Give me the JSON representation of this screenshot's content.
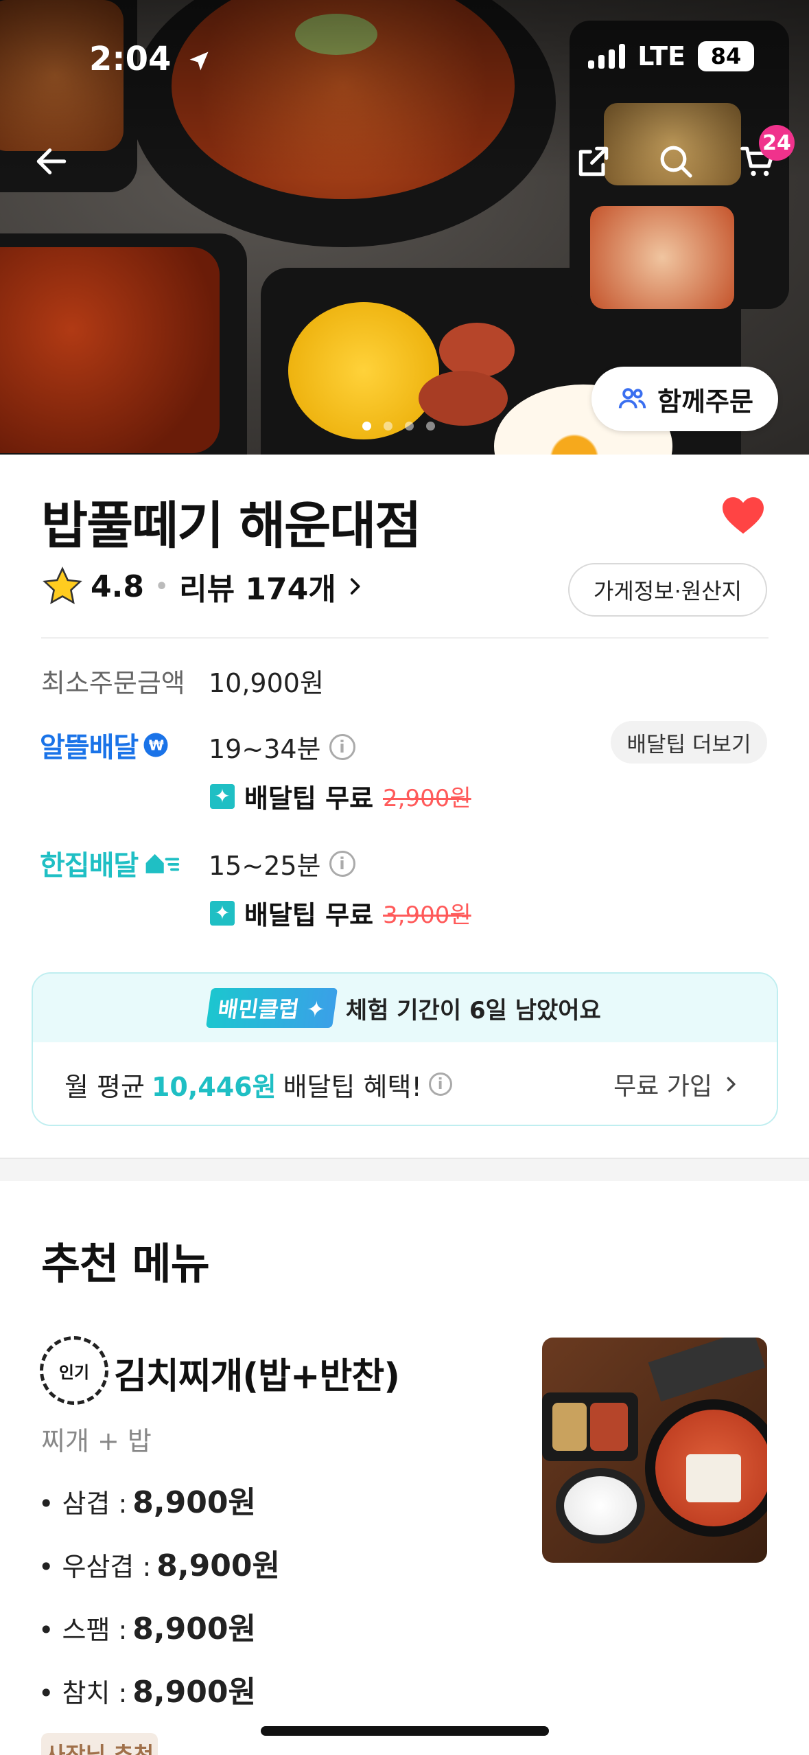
{
  "status_bar": {
    "time": "2:04",
    "network": "LTE",
    "battery": "84"
  },
  "header": {
    "cart_count": "24",
    "group_order_label": "함께주문"
  },
  "store": {
    "name": "밥풀떼기 해운대점",
    "rating": "4.8",
    "review_label": "리뷰 174개",
    "info_button": "가게정보·원산지",
    "favorited": true
  },
  "min_order": {
    "label": "최소주문금액",
    "value": "10,900원"
  },
  "delivery": {
    "economy": {
      "brand": "알뜰배달",
      "time": "19~34분",
      "tip_free": "배달팁 무료",
      "tip_original": "2,900원",
      "more_label": "배달팁 더보기"
    },
    "single": {
      "brand": "한집배달",
      "time": "15~25분",
      "tip_free": "배달팁 무료",
      "tip_original": "3,900원"
    }
  },
  "club": {
    "badge": "배민클럽",
    "message": "체험 기간이 6일 남았어요",
    "prefix": "월 평균",
    "amount": "10,446원",
    "suffix": "배달팁 혜택!",
    "cta": "무료 가입"
  },
  "recommended": {
    "title": "추천 메뉴",
    "item": {
      "badge": "인기",
      "name": "김치찌개(밥+반찬)",
      "desc": "찌개 + 밥",
      "options": [
        {
          "label": "• 삼겹 :",
          "price": "8,900원"
        },
        {
          "label": "• 우삼겹 :",
          "price": "8,900원"
        },
        {
          "label": "• 스팸 :",
          "price": "8,900원"
        },
        {
          "label": "• 참치 :",
          "price": "8,900원"
        }
      ],
      "tag": "사장님 추천"
    }
  },
  "colors": {
    "accent_teal": "#1fbfc4",
    "accent_blue": "#1a73e8",
    "heart": "#ff4444",
    "badge_pink": "#f0328c",
    "strike_red": "#ff5a5a"
  },
  "icons": [
    "back-arrow-icon",
    "share-icon",
    "search-icon",
    "cart-icon",
    "people-icon",
    "heart-icon",
    "star-icon",
    "chevron-right-icon",
    "info-icon",
    "delivery-tip-icon"
  ]
}
